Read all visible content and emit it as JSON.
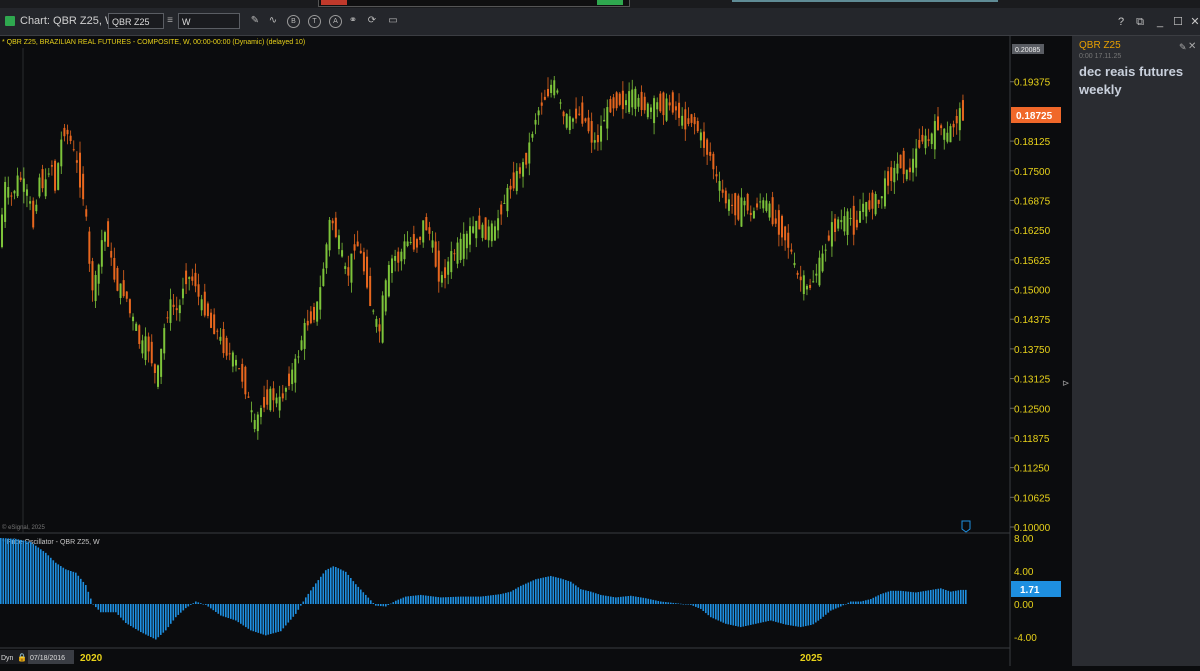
{
  "window": {
    "title": "Chart: QBR Z25, W",
    "symbol_value": "QBR Z25",
    "interval_value": "W",
    "menu_glyph": "≡",
    "help_glyph": "?",
    "restore_glyph": "⧉",
    "minimize_glyph": "_",
    "maximize_glyph": "☐",
    "close_glyph": "✕"
  },
  "toolbar": {
    "icons": [
      "pencil-icon",
      "wave-icon",
      "b-circle-icon",
      "t-circle-icon",
      "a-circle-icon",
      "link-icon",
      "sync-icon",
      "chat-icon"
    ],
    "labels": {
      "b": "B",
      "t": "T",
      "a": "A"
    }
  },
  "price_pane": {
    "header": "* QBR Z25, BRAZILIAN REAL FUTURES - COMPOSITE, W, 00:00-00:00 (Dynamic) (delayed 10)",
    "watermark": "© eSignal, 2025",
    "ticks": [
      "0.19375",
      "0.18125",
      "0.17500",
      "0.16875",
      "0.16250",
      "0.15625",
      "0.15000",
      "0.14375",
      "0.13750",
      "0.13125",
      "0.12500",
      "0.11875",
      "0.11250",
      "0.10625",
      "0.10000"
    ],
    "top_tag": "0.20085",
    "last_price": "0.18725"
  },
  "osc_pane": {
    "header": "* Price Oscillator - QBR Z25, W",
    "ticks": [
      "8.00",
      "4.00",
      "0.00",
      "-4.00"
    ],
    "last_value": "1.71"
  },
  "footer": {
    "dyn": "Dyn",
    "start_date": "07/18/2016",
    "year_labels": [
      "2020",
      "2025"
    ]
  },
  "note_panel": {
    "symbol": "QBR Z25",
    "timestamp": "0:00 17.11.25",
    "note": "dec reais futures weekly"
  },
  "colors": {
    "up": "#7dc43a",
    "down": "#e8671e",
    "osc": "#1e8fe0",
    "last_price_bg": "#f0682a",
    "osc_tag_bg": "#1e8fe0",
    "accent_text": "#e8d21a"
  },
  "chart_data": [
    {
      "type": "candlestick",
      "title": "QBR Z25, BRAZILIAN REAL FUTURES - COMPOSITE, W",
      "ylim": [
        0.1,
        0.20085
      ],
      "last": 0.18725,
      "waypoints": [
        [
          0,
          0.159
        ],
        [
          6,
          0.172
        ],
        [
          12,
          0.169
        ],
        [
          20,
          0.174
        ],
        [
          25,
          0.172
        ],
        [
          31,
          0.168
        ],
        [
          34,
          0.163
        ],
        [
          40,
          0.174
        ],
        [
          46,
          0.171
        ],
        [
          52,
          0.178
        ],
        [
          56,
          0.171
        ],
        [
          62,
          0.181
        ],
        [
          66,
          0.184
        ],
        [
          72,
          0.181
        ],
        [
          78,
          0.176
        ],
        [
          82,
          0.172
        ],
        [
          86,
          0.168
        ],
        [
          92,
          0.15
        ],
        [
          98,
          0.152
        ],
        [
          104,
          0.162
        ],
        [
          108,
          0.162
        ],
        [
          112,
          0.156
        ],
        [
          116,
          0.152
        ],
        [
          120,
          0.15
        ],
        [
          124,
          0.15
        ],
        [
          128,
          0.148
        ],
        [
          132,
          0.144
        ],
        [
          136,
          0.143
        ],
        [
          140,
          0.139
        ],
        [
          144,
          0.138
        ],
        [
          148,
          0.139
        ],
        [
          152,
          0.136
        ],
        [
          156,
          0.132
        ],
        [
          160,
          0.133
        ],
        [
          164,
          0.14
        ],
        [
          168,
          0.145
        ],
        [
          172,
          0.147
        ],
        [
          176,
          0.146
        ],
        [
          180,
          0.145
        ],
        [
          184,
          0.151
        ],
        [
          188,
          0.153
        ],
        [
          192,
          0.152
        ],
        [
          196,
          0.152
        ],
        [
          200,
          0.148
        ],
        [
          204,
          0.146
        ],
        [
          208,
          0.146
        ],
        [
          212,
          0.142
        ],
        [
          216,
          0.142
        ],
        [
          220,
          0.14
        ],
        [
          224,
          0.138
        ],
        [
          228,
          0.137
        ],
        [
          232,
          0.136
        ],
        [
          236,
          0.135
        ],
        [
          240,
          0.133
        ],
        [
          244,
          0.131
        ],
        [
          248,
          0.128
        ],
        [
          252,
          0.124
        ],
        [
          256,
          0.121
        ],
        [
          260,
          0.124
        ],
        [
          264,
          0.126
        ],
        [
          268,
          0.127
        ],
        [
          272,
          0.128
        ],
        [
          276,
          0.127
        ],
        [
          280,
          0.126
        ],
        [
          284,
          0.128
        ],
        [
          288,
          0.13
        ],
        [
          292,
          0.132
        ],
        [
          296,
          0.134
        ],
        [
          300,
          0.137
        ],
        [
          304,
          0.141
        ],
        [
          308,
          0.143
        ],
        [
          312,
          0.144
        ],
        [
          316,
          0.145
        ],
        [
          320,
          0.148
        ],
        [
          324,
          0.154
        ],
        [
          328,
          0.16
        ],
        [
          332,
          0.166
        ],
        [
          336,
          0.162
        ],
        [
          340,
          0.16
        ],
        [
          344,
          0.156
        ],
        [
          348,
          0.152
        ],
        [
          352,
          0.156
        ],
        [
          356,
          0.16
        ],
        [
          360,
          0.159
        ],
        [
          364,
          0.155
        ],
        [
          368,
          0.152
        ],
        [
          372,
          0.146
        ],
        [
          376,
          0.144
        ],
        [
          380,
          0.14
        ],
        [
          384,
          0.148
        ],
        [
          388,
          0.152
        ],
        [
          392,
          0.156
        ],
        [
          396,
          0.157
        ],
        [
          400,
          0.156
        ],
        [
          404,
          0.159
        ],
        [
          408,
          0.16
        ],
        [
          412,
          0.16
        ],
        [
          416,
          0.159
        ],
        [
          420,
          0.16
        ],
        [
          424,
          0.164
        ],
        [
          428,
          0.163
        ],
        [
          432,
          0.161
        ],
        [
          436,
          0.156
        ],
        [
          440,
          0.153
        ],
        [
          444,
          0.152
        ],
        [
          448,
          0.155
        ],
        [
          452,
          0.157
        ],
        [
          456,
          0.158
        ],
        [
          460,
          0.159
        ],
        [
          464,
          0.16
        ],
        [
          468,
          0.161
        ],
        [
          472,
          0.163
        ],
        [
          476,
          0.163
        ],
        [
          480,
          0.164
        ],
        [
          484,
          0.162
        ],
        [
          488,
          0.162
        ],
        [
          492,
          0.163
        ],
        [
          496,
          0.162
        ],
        [
          500,
          0.166
        ],
        [
          504,
          0.168
        ],
        [
          508,
          0.17
        ],
        [
          512,
          0.172
        ],
        [
          516,
          0.173
        ],
        [
          520,
          0.175
        ],
        [
          524,
          0.176
        ],
        [
          528,
          0.178
        ],
        [
          532,
          0.182
        ],
        [
          536,
          0.186
        ],
        [
          540,
          0.188
        ],
        [
          544,
          0.19
        ],
        [
          548,
          0.191
        ],
        [
          552,
          0.193
        ],
        [
          556,
          0.193
        ],
        [
          560,
          0.19
        ],
        [
          564,
          0.186
        ],
        [
          568,
          0.186
        ],
        [
          572,
          0.185
        ],
        [
          576,
          0.187
        ],
        [
          580,
          0.187
        ],
        [
          584,
          0.186
        ],
        [
          588,
          0.185
        ],
        [
          592,
          0.182
        ],
        [
          596,
          0.181
        ],
        [
          600,
          0.182
        ],
        [
          604,
          0.186
        ],
        [
          608,
          0.187
        ],
        [
          612,
          0.189
        ],
        [
          616,
          0.189
        ],
        [
          620,
          0.19
        ],
        [
          624,
          0.189
        ],
        [
          628,
          0.19
        ],
        [
          632,
          0.191
        ],
        [
          636,
          0.191
        ],
        [
          640,
          0.189
        ],
        [
          644,
          0.189
        ],
        [
          648,
          0.188
        ],
        [
          652,
          0.188
        ],
        [
          656,
          0.189
        ],
        [
          660,
          0.189
        ],
        [
          664,
          0.188
        ],
        [
          668,
          0.189
        ],
        [
          672,
          0.189
        ],
        [
          676,
          0.188
        ],
        [
          680,
          0.187
        ],
        [
          684,
          0.185
        ],
        [
          688,
          0.185
        ],
        [
          692,
          0.186
        ],
        [
          696,
          0.185
        ],
        [
          700,
          0.183
        ],
        [
          704,
          0.181
        ],
        [
          708,
          0.179
        ],
        [
          712,
          0.178
        ],
        [
          716,
          0.174
        ],
        [
          720,
          0.172
        ],
        [
          724,
          0.17
        ],
        [
          728,
          0.168
        ],
        [
          732,
          0.168
        ],
        [
          736,
          0.167
        ],
        [
          740,
          0.166
        ],
        [
          744,
          0.169
        ],
        [
          748,
          0.168
        ],
        [
          752,
          0.165
        ],
        [
          756,
          0.167
        ],
        [
          760,
          0.169
        ],
        [
          764,
          0.168
        ],
        [
          768,
          0.168
        ],
        [
          772,
          0.166
        ],
        [
          776,
          0.164
        ],
        [
          780,
          0.163
        ],
        [
          784,
          0.162
        ],
        [
          788,
          0.16
        ],
        [
          792,
          0.158
        ],
        [
          796,
          0.154
        ],
        [
          800,
          0.152
        ],
        [
          804,
          0.152
        ],
        [
          808,
          0.15
        ],
        [
          812,
          0.151
        ],
        [
          816,
          0.153
        ],
        [
          820,
          0.155
        ],
        [
          824,
          0.157
        ],
        [
          828,
          0.16
        ],
        [
          832,
          0.163
        ],
        [
          836,
          0.163
        ],
        [
          840,
          0.165
        ],
        [
          844,
          0.164
        ],
        [
          848,
          0.165
        ],
        [
          852,
          0.165
        ],
        [
          856,
          0.162
        ],
        [
          860,
          0.166
        ],
        [
          864,
          0.168
        ],
        [
          868,
          0.167
        ],
        [
          872,
          0.168
        ],
        [
          876,
          0.169
        ],
        [
          880,
          0.168
        ],
        [
          884,
          0.171
        ],
        [
          888,
          0.173
        ],
        [
          892,
          0.174
        ],
        [
          896,
          0.175
        ],
        [
          900,
          0.177
        ],
        [
          904,
          0.176
        ],
        [
          908,
          0.174
        ],
        [
          912,
          0.176
        ],
        [
          916,
          0.178
        ],
        [
          920,
          0.181
        ],
        [
          924,
          0.182
        ],
        [
          928,
          0.181
        ],
        [
          932,
          0.182
        ],
        [
          936,
          0.184
        ],
        [
          940,
          0.185
        ],
        [
          944,
          0.183
        ],
        [
          948,
          0.182
        ],
        [
          952,
          0.184
        ],
        [
          956,
          0.185
        ],
        [
          960,
          0.187
        ],
        [
          964,
          0.187
        ]
      ]
    },
    {
      "type": "bar",
      "title": "Price Oscillator - QBR Z25, W",
      "ylim": [
        -6,
        8
      ],
      "last": 1.71,
      "waypoints": [
        [
          0,
          8
        ],
        [
          15,
          7.9
        ],
        [
          30,
          7.5
        ],
        [
          45,
          6.2
        ],
        [
          55,
          5
        ],
        [
          65,
          4.2
        ],
        [
          75,
          3.8
        ],
        [
          85,
          2.3
        ],
        [
          92,
          0
        ],
        [
          100,
          -1
        ],
        [
          115,
          -1
        ],
        [
          125,
          -2.3
        ],
        [
          140,
          -3.4
        ],
        [
          155,
          -4.3
        ],
        [
          165,
          -3.2
        ],
        [
          175,
          -1.6
        ],
        [
          185,
          -0.5
        ],
        [
          195,
          0.3
        ],
        [
          205,
          -0.1
        ],
        [
          220,
          -1.4
        ],
        [
          235,
          -2
        ],
        [
          250,
          -3.2
        ],
        [
          265,
          -3.8
        ],
        [
          280,
          -3.3
        ],
        [
          295,
          -1.2
        ],
        [
          305,
          0.8
        ],
        [
          315,
          2.5
        ],
        [
          325,
          4.1
        ],
        [
          333,
          4.6
        ],
        [
          345,
          3.9
        ],
        [
          355,
          2.4
        ],
        [
          365,
          1.1
        ],
        [
          375,
          -0.2
        ],
        [
          385,
          -0.3
        ],
        [
          395,
          0.4
        ],
        [
          405,
          0.9
        ],
        [
          420,
          1.1
        ],
        [
          440,
          0.8
        ],
        [
          460,
          0.9
        ],
        [
          480,
          0.9
        ],
        [
          500,
          1.2
        ],
        [
          510,
          1.5
        ],
        [
          520,
          2.2
        ],
        [
          535,
          3
        ],
        [
          550,
          3.4
        ],
        [
          560,
          3.1
        ],
        [
          570,
          2.7
        ],
        [
          580,
          1.8
        ],
        [
          590,
          1.5
        ],
        [
          600,
          1.1
        ],
        [
          615,
          0.8
        ],
        [
          630,
          1
        ],
        [
          645,
          0.7
        ],
        [
          660,
          0.3
        ],
        [
          675,
          0.1
        ],
        [
          690,
          -0.1
        ],
        [
          700,
          -0.6
        ],
        [
          710,
          -1.6
        ],
        [
          725,
          -2.4
        ],
        [
          740,
          -2.8
        ],
        [
          755,
          -2.4
        ],
        [
          770,
          -2
        ],
        [
          785,
          -2.5
        ],
        [
          800,
          -2.8
        ],
        [
          812,
          -2.5
        ],
        [
          820,
          -1.8
        ],
        [
          830,
          -0.8
        ],
        [
          840,
          -0.3
        ],
        [
          850,
          0.3
        ],
        [
          860,
          0.3
        ],
        [
          870,
          0.6
        ],
        [
          880,
          1.2
        ],
        [
          890,
          1.6
        ],
        [
          900,
          1.6
        ],
        [
          915,
          1.4
        ],
        [
          930,
          1.7
        ],
        [
          940,
          1.9
        ],
        [
          950,
          1.5
        ],
        [
          960,
          1.71
        ]
      ]
    }
  ]
}
